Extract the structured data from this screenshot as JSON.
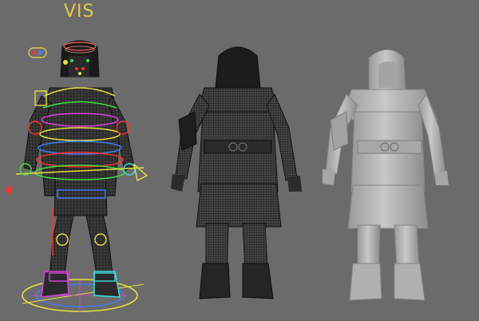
{
  "viewport": {
    "vis_label": "VIS",
    "background_color": "#6b6b6b"
  },
  "figures": [
    {
      "name": "rigged-character",
      "display_mode": "wireframe-with-rig-controls"
    },
    {
      "name": "wireframe-character",
      "display_mode": "wireframe-mesh"
    },
    {
      "name": "shaded-character",
      "display_mode": "smooth-shaded"
    }
  ],
  "colors": {
    "rig_yellow": "#e8e040",
    "rig_red": "#ff3030",
    "rig_green": "#40e040",
    "rig_blue": "#4080ff",
    "rig_magenta": "#e040e0",
    "rig_cyan": "#40e0e0",
    "mesh_dark": "#111111",
    "shaded_gray": "#b8b8b8"
  }
}
